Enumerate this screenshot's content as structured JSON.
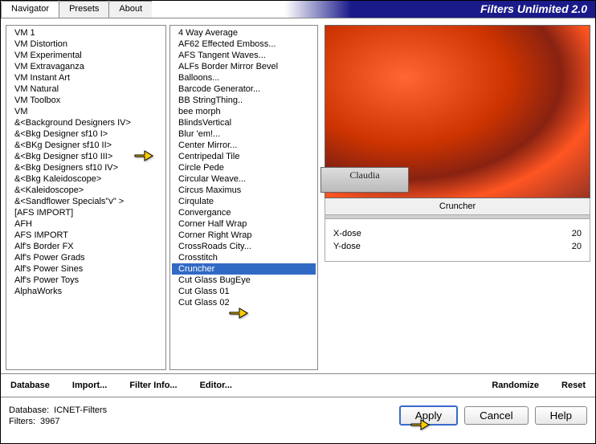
{
  "title": "Filters Unlimited 2.0",
  "tabs": {
    "navigator": "Navigator",
    "presets": "Presets",
    "about": "About"
  },
  "list1": [
    "VM 1",
    "VM Distortion",
    "VM Experimental",
    "VM Extravaganza",
    "VM Instant Art",
    "VM Natural",
    "VM Toolbox",
    "VM",
    "&<Background Designers IV>",
    "&<Bkg Designer sf10 I>",
    "&<BKg Designer sf10 II>",
    "&<Bkg Designer sf10 III>",
    "&<Bkg Designers sf10 IV>",
    "&<Bkg Kaleidoscope>",
    "&<Kaleidoscope>",
    "&<Sandflower Specials\"v\" >",
    "[AFS IMPORT]",
    "AFH",
    "AFS IMPORT",
    "Alf's Border FX",
    "Alf's Power Grads",
    "Alf's Power Sines",
    "Alf's Power Toys",
    "AlphaWorks"
  ],
  "list1_selected_index": 9,
  "list2": [
    "4 Way Average",
    "AF62 Effected Emboss...",
    "AFS Tangent Waves...",
    "ALFs Border Mirror Bevel",
    "Balloons...",
    "Barcode Generator...",
    "BB StringThing..",
    "bee morph",
    "BlindsVertical",
    "Blur 'em!...",
    "Center Mirror...",
    "Centripedal Tile",
    "Circle Pede",
    "Circular Weave...",
    "Circus Maximus",
    "Cirqulate",
    "Convergance",
    "Corner Half Wrap",
    "Corner Right Wrap",
    "CrossRoads City...",
    "Crosstitch",
    "Cruncher",
    "Cut Glass  BugEye",
    "Cut Glass 01",
    "Cut Glass 02"
  ],
  "list2_selected_index": 21,
  "filter_name": "Cruncher",
  "params": [
    {
      "label": "X-dose",
      "value": "20"
    },
    {
      "label": "Y-dose",
      "value": "20"
    }
  ],
  "toolbar": {
    "database": "Database",
    "import": "Import...",
    "filter_info": "Filter Info...",
    "editor": "Editor...",
    "randomize": "Randomize",
    "reset": "Reset"
  },
  "footer": {
    "db_label": "Database:",
    "db_value": "ICNET-Filters",
    "filters_label": "Filters:",
    "filters_value": "3967",
    "apply": "Apply",
    "cancel": "Cancel",
    "help": "Help"
  },
  "watermark": "Claudia"
}
